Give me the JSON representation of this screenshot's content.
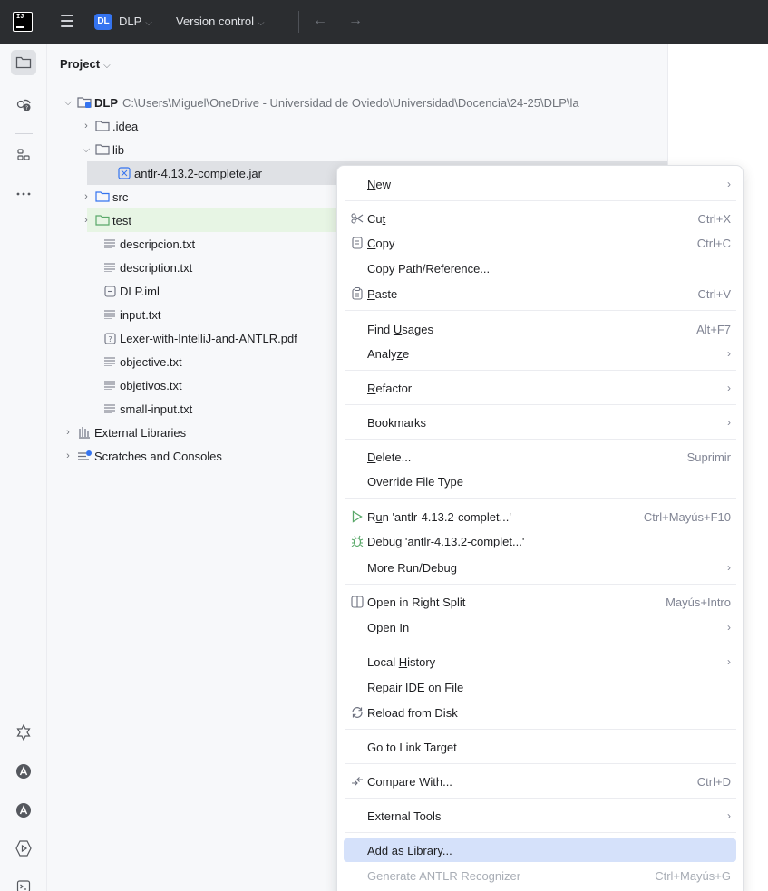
{
  "titlebar": {
    "app_logo": "IJ",
    "project_badge": "DL",
    "project_name": "DLP",
    "vcs_label": "Version control",
    "chevron": "⌵",
    "back_arrow": "←",
    "forward_arrow": "→"
  },
  "toolwindow_icons": [
    "project-icon",
    "commit-icon",
    "structure-icon",
    "more-icon",
    "notifications-icon",
    "ai-icon",
    "ai-assistant-icon",
    "run-icon",
    "terminal-icon"
  ],
  "project_panel": {
    "title": "Project",
    "tree": [
      {
        "arrow": "⌵",
        "icon": "module-icon",
        "label": "DLP",
        "path": "C:\\Users\\Miguel\\OneDrive - Universidad de Oviedo\\Universidad\\Docencia\\24-25\\DLP\\la"
      },
      {
        "arrow": "›",
        "icon": "folder-icon",
        "label": ".idea"
      },
      {
        "arrow": "⌵",
        "icon": "folder-icon",
        "label": "lib"
      },
      {
        "arrow": "",
        "icon": "jar-icon",
        "label": "antlr-4.13.2-complete.jar"
      },
      {
        "arrow": "›",
        "icon": "source-folder-icon",
        "label": "src"
      },
      {
        "arrow": "›",
        "icon": "test-folder-icon",
        "label": "test"
      },
      {
        "arrow": "",
        "icon": "text-file-icon",
        "label": "descripcion.txt"
      },
      {
        "arrow": "",
        "icon": "text-file-icon",
        "label": "description.txt"
      },
      {
        "arrow": "",
        "icon": "iml-file-icon",
        "label": "DLP.iml"
      },
      {
        "arrow": "",
        "icon": "text-file-icon",
        "label": "input.txt"
      },
      {
        "arrow": "",
        "icon": "unknown-file-icon",
        "label": "Lexer-with-IntelliJ-and-ANTLR.pdf"
      },
      {
        "arrow": "",
        "icon": "text-file-icon",
        "label": "objective.txt"
      },
      {
        "arrow": "",
        "icon": "text-file-icon",
        "label": "objetivos.txt"
      },
      {
        "arrow": "",
        "icon": "text-file-icon",
        "label": "small-input.txt"
      },
      {
        "arrow": "›",
        "icon": "libraries-icon",
        "label": "External Libraries"
      },
      {
        "arrow": "›",
        "icon": "scratches-icon",
        "label": "Scratches and Consoles"
      }
    ]
  },
  "context_menu": {
    "submenu_glyph": "›",
    "items": [
      {
        "pre": "",
        "mn": "N",
        "post": "ew",
        "shortcut": "",
        "submenu": true
      },
      {
        "pre": "Cu",
        "mn": "t",
        "post": "",
        "shortcut": "Ctrl+X",
        "icon": "cut-icon"
      },
      {
        "pre": "",
        "mn": "C",
        "post": "opy",
        "shortcut": "Ctrl+C",
        "icon": "copy-icon"
      },
      {
        "pre": "Copy Path/Reference...",
        "mn": "",
        "post": "",
        "shortcut": ""
      },
      {
        "pre": "",
        "mn": "P",
        "post": "aste",
        "shortcut": "Ctrl+V",
        "icon": "paste-icon"
      },
      {
        "pre": "Find ",
        "mn": "U",
        "post": "sages",
        "shortcut": "Alt+F7"
      },
      {
        "pre": "Analy",
        "mn": "z",
        "post": "e",
        "shortcut": "",
        "submenu": true
      },
      {
        "pre": "",
        "mn": "R",
        "post": "efactor",
        "shortcut": "",
        "submenu": true
      },
      {
        "pre": "Bookmarks",
        "mn": "",
        "post": "",
        "shortcut": "",
        "submenu": true
      },
      {
        "pre": "",
        "mn": "D",
        "post": "elete...",
        "shortcut": "Suprimir"
      },
      {
        "pre": "Override File Type",
        "mn": "",
        "post": "",
        "shortcut": ""
      },
      {
        "pre": "R",
        "mn": "u",
        "post": "n 'antlr-4.13.2-complet...'",
        "shortcut": "Ctrl+Mayús+F10",
        "icon": "run-icon"
      },
      {
        "pre": "",
        "mn": "D",
        "post": "ebug 'antlr-4.13.2-complet...'",
        "shortcut": "",
        "icon": "debug-icon"
      },
      {
        "pre": "More Run/Debug",
        "mn": "",
        "post": "",
        "shortcut": "",
        "submenu": true
      },
      {
        "pre": "Open in Right Split",
        "mn": "",
        "post": "",
        "shortcut": "Mayús+Intro",
        "icon": "split-icon"
      },
      {
        "pre": "Open In",
        "mn": "",
        "post": "",
        "shortcut": "",
        "submenu": true
      },
      {
        "pre": "Local ",
        "mn": "H",
        "post": "istory",
        "shortcut": "",
        "submenu": true
      },
      {
        "pre": "Repair IDE on File",
        "mn": "",
        "post": "",
        "shortcut": ""
      },
      {
        "pre": "Reload from Disk",
        "mn": "",
        "post": "",
        "shortcut": "",
        "icon": "reload-icon"
      },
      {
        "pre": "Go to Link Target",
        "mn": "",
        "post": "",
        "shortcut": ""
      },
      {
        "pre": "Compare With...",
        "mn": "",
        "post": "",
        "shortcut": "Ctrl+D",
        "icon": "compare-icon"
      },
      {
        "pre": "External Tools",
        "mn": "",
        "post": "",
        "shortcut": "",
        "submenu": true
      },
      {
        "pre": "Add as Library...",
        "mn": "",
        "post": "",
        "shortcut": "",
        "highlighted": true
      },
      {
        "pre": "Generate ANTLR Recognizer",
        "mn": "",
        "post": "",
        "shortcut": "Ctrl+Mayús+G",
        "disabled": true
      }
    ]
  },
  "colors": {
    "titlebar": "#2b2d30",
    "selection": "#dfe1e5",
    "test_row": "#e7f5e4",
    "menu_highlight": "#d5e1fa",
    "accent": "#3574f0"
  }
}
